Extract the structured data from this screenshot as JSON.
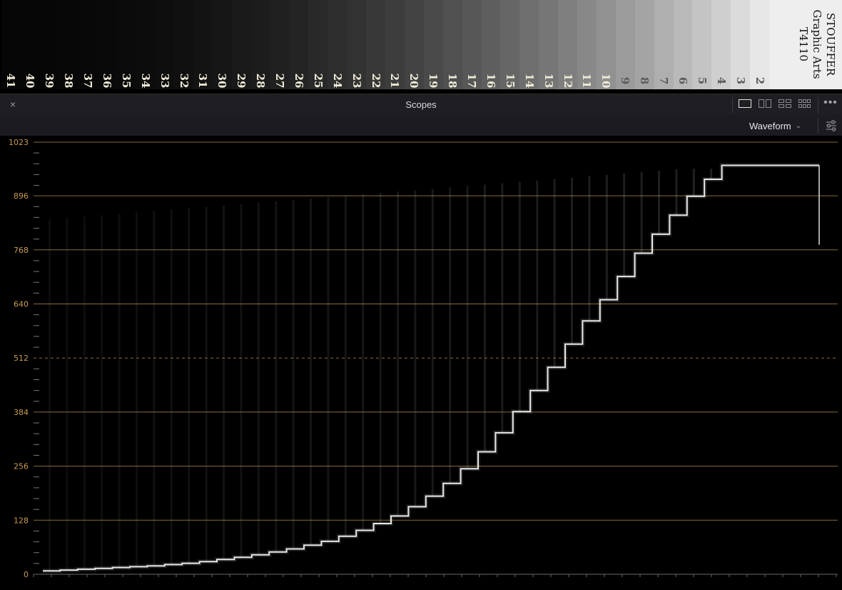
{
  "step_wedge": {
    "labels": [
      "41",
      "40",
      "39",
      "38",
      "37",
      "36",
      "35",
      "34",
      "33",
      "32",
      "31",
      "30",
      "29",
      "28",
      "27",
      "26",
      "25",
      "24",
      "23",
      "22",
      "21",
      "20",
      "19",
      "18",
      "17",
      "16",
      "15",
      "14",
      "13",
      "12",
      "11",
      "10",
      "9",
      "8",
      "7",
      "6",
      "5",
      "4",
      "3",
      "2"
    ],
    "brand": [
      "STOUFFER",
      "Graphic Arts",
      "T4110"
    ],
    "trademark": "®"
  },
  "panel": {
    "title": "Scopes",
    "close_icon": "×",
    "more_icon": "•••"
  },
  "toolbar": {
    "scope_type": "Waveform",
    "chevron": "⌄"
  },
  "waveform": {
    "y_ticks": [
      "1023",
      "896",
      "768",
      "640",
      "512",
      "384",
      "256",
      "128",
      "0"
    ],
    "grid_color": "#8a6a3a",
    "tick_color": "#c79a55",
    "trace_color": "#ffffff",
    "step_levels": [
      8,
      10,
      12,
      14,
      16,
      18,
      20,
      23,
      26,
      30,
      35,
      40,
      46,
      53,
      60,
      69,
      78,
      90,
      104,
      120,
      138,
      160,
      185,
      215,
      250,
      290,
      335,
      385,
      435,
      490,
      545,
      600,
      650,
      705,
      760,
      805,
      850,
      895,
      935,
      968
    ]
  }
}
